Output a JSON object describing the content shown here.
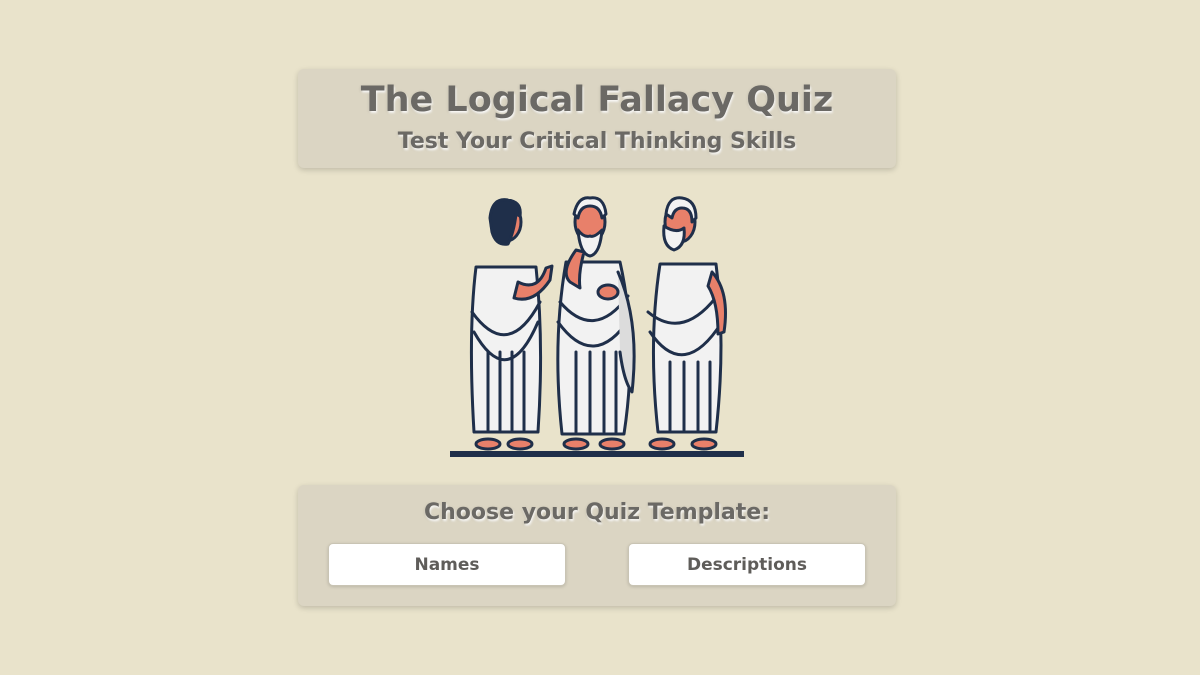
{
  "header": {
    "title": "The Logical Fallacy Quiz",
    "subtitle": "Test Your Critical Thinking Skills"
  },
  "illustration": {
    "subject": "three-philosophers-in-togas"
  },
  "template_chooser": {
    "heading": "Choose your Quiz Template:",
    "options": [
      {
        "label": "Names"
      },
      {
        "label": "Descriptions"
      }
    ]
  },
  "colors": {
    "background": "#e9e3cb",
    "card": "#dbd5c3",
    "text": "#6b6965",
    "outline": "#1f2f4a",
    "skin": "#e8806a",
    "robe": "#f2f2f2"
  }
}
